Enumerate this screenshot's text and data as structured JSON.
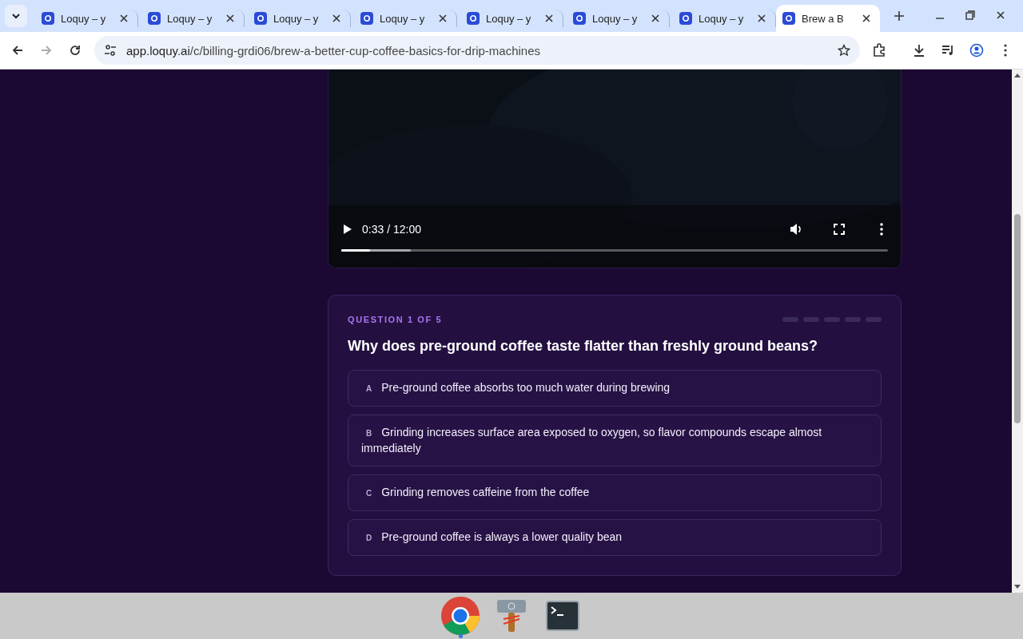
{
  "browser": {
    "tabs": [
      {
        "title": "Loquy – y",
        "selected": false
      },
      {
        "title": "Loquy – y",
        "selected": false
      },
      {
        "title": "Loquy – y",
        "selected": false
      },
      {
        "title": "Loquy – y",
        "selected": false
      },
      {
        "title": "Loquy – y",
        "selected": false
      },
      {
        "title": "Loquy – y",
        "selected": false
      },
      {
        "title": "Loquy – y",
        "selected": false
      },
      {
        "title": "Brew a B",
        "selected": true
      }
    ],
    "url_host": "app.loquy.ai",
    "url_path": "/c/billing-grdi06/brew-a-better-cup-coffee-basics-for-drip-machines"
  },
  "video": {
    "kind": "picture",
    "time": "0:33 / 12:00",
    "progress": {
      "level": 0.052
    },
    "buffered": {
      "level": 0.127
    }
  },
  "quiz": {
    "counter": "QUESTION 1 OF 5",
    "steps": [
      {
        "done": false
      },
      {
        "done": false
      },
      {
        "done": false
      },
      {
        "done": false
      },
      {
        "done": false
      }
    ],
    "question": "Why does pre-ground coffee taste flatter than freshly ground beans?",
    "options": [
      {
        "letter": "A",
        "text": "Pre-ground coffee absorbs too much water during brewing",
        "selected": false
      },
      {
        "letter": "B",
        "text": "Grinding increases surface area exposed to oxygen, so flavor compounds escape almost immediately",
        "selected": false
      },
      {
        "letter": "C",
        "text": "Grinding removes caffeine from the coffee",
        "selected": false
      },
      {
        "letter": "D",
        "text": "Pre-ground coffee is always a lower quality bean",
        "selected": false
      }
    ]
  },
  "taskbar": {
    "apps": [
      {
        "kind": "chrome",
        "running": true
      },
      {
        "kind": "hammer",
        "running": false
      },
      {
        "kind": "terminal",
        "running": false
      }
    ]
  }
}
